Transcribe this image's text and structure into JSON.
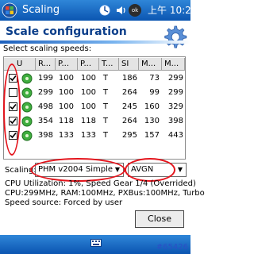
{
  "taskbar": {
    "app_name": "Scaling",
    "clock": "上午 10:28",
    "tray_badge": "ok"
  },
  "header": {
    "title": "Scale configuration"
  },
  "select_label": "Select scaling speeds:",
  "table": {
    "columns": [
      "U",
      "R...",
      "P...",
      "P...",
      "T...",
      "SI",
      "M...",
      "M..."
    ],
    "rows": [
      {
        "checked": true,
        "cpu": "199",
        "ram": "100",
        "pxbus": "100",
        "turbo": "T",
        "si": "186",
        "m1": "73",
        "m2": "299"
      },
      {
        "checked": false,
        "cpu": "299",
        "ram": "100",
        "pxbus": "100",
        "turbo": "T",
        "si": "264",
        "m1": "99",
        "m2": "299"
      },
      {
        "checked": true,
        "cpu": "498",
        "ram": "100",
        "pxbus": "100",
        "turbo": "T",
        "si": "245",
        "m1": "160",
        "m2": "329"
      },
      {
        "checked": true,
        "cpu": "354",
        "ram": "118",
        "pxbus": "118",
        "turbo": "T",
        "si": "264",
        "m1": "130",
        "m2": "398"
      },
      {
        "checked": true,
        "cpu": "398",
        "ram": "133",
        "pxbus": "133",
        "turbo": "T",
        "si": "295",
        "m1": "157",
        "m2": "443"
      }
    ]
  },
  "scaling": {
    "label": "Scaling:",
    "mode_value": "PHM v2004 Simple",
    "governor_value": "AVGN"
  },
  "info": {
    "line1": "CPU Utilization: 1%, Speed Gear 1/4 (Overrided)",
    "line2": "CPU:299MHz, RAM:100MHz, PXBus:100MHz, Turbo",
    "line3": "Speed source: Forced by user"
  },
  "close_label": "Close",
  "watermark": "#65426",
  "colors": {
    "taskbar": "#0b55b1",
    "title": "#0b3e8a",
    "annotation": "#e4141c"
  }
}
